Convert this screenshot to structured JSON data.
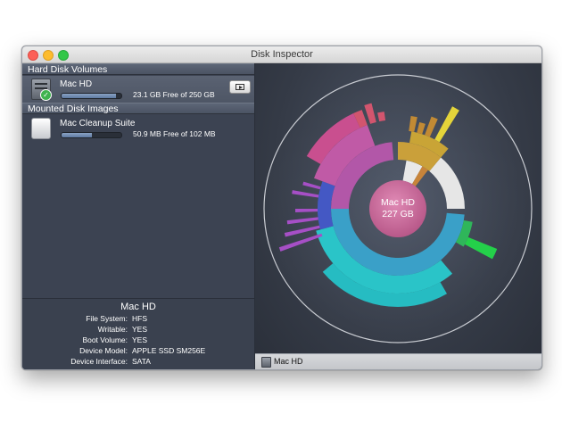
{
  "window": {
    "title": "Disk Inspector"
  },
  "sections": {
    "hard_disks": "Hard Disk Volumes",
    "mounted_images": "Mounted Disk Images"
  },
  "volumes": [
    {
      "name": "Mac HD",
      "free_text": "23.1 GB Free of 250 GB",
      "used_fraction": 0.908
    },
    {
      "name": "Mac Cleanup Suite",
      "free_text": "50.9 MB Free of 102 MB",
      "used_fraction": 0.5
    }
  ],
  "info": {
    "title": "Mac HD",
    "rows": [
      {
        "label": "File System:",
        "value": "HFS"
      },
      {
        "label": "Writable:",
        "value": "YES"
      },
      {
        "label": "Boot Volume:",
        "value": "YES"
      },
      {
        "label": "Device Model:",
        "value": "APPLE SSD SM256E"
      },
      {
        "label": "Device Interface:",
        "value": "SATA"
      }
    ]
  },
  "center": {
    "name": "Mac HD",
    "size": "227 GB"
  },
  "status": {
    "path": "Mac HD"
  },
  "icons": [
    "hard-disk-icon",
    "checkmark-icon",
    "disk-image-icon",
    "play-icon"
  ]
}
